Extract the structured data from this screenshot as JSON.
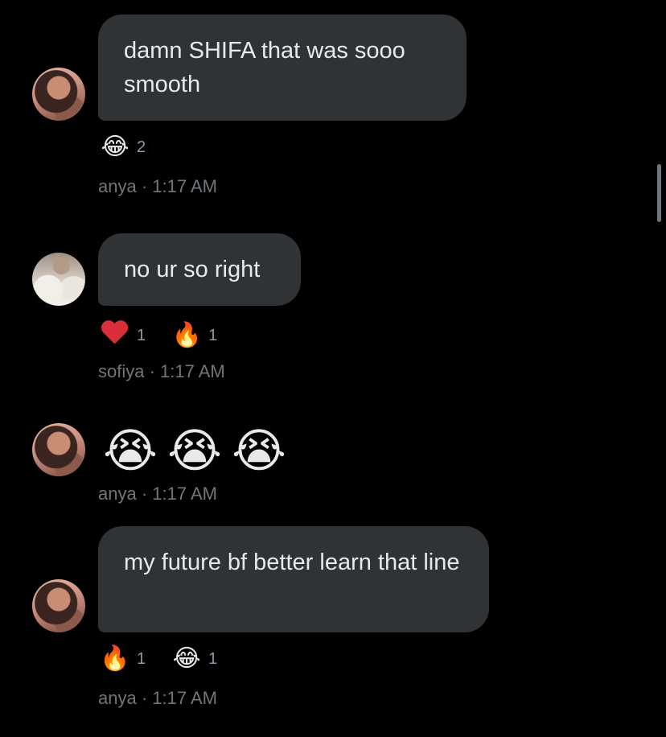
{
  "messages": [
    {
      "author": "anya",
      "text": "damn SHIFA that was sooo smooth",
      "reactions": [
        {
          "emoji": "😂",
          "icon": "face-with-tears-of-joy-icon",
          "count": "2"
        }
      ],
      "meta": "anya · 1:17 AM"
    },
    {
      "author": "sofiya",
      "text": "no ur so right",
      "reactions": [
        {
          "emoji": "❤",
          "icon": "red-heart-icon",
          "count": "1"
        },
        {
          "emoji": "🔥",
          "icon": "fire-icon",
          "count": "1"
        }
      ],
      "meta": "sofiya · 1:17 AM"
    },
    {
      "author": "anya",
      "emojis": [
        "😭",
        "😭",
        "😭"
      ],
      "emoji_icon": "loudly-crying-face-icon",
      "meta": "anya · 1:17 AM"
    },
    {
      "author": "anya",
      "text": "my future bf better learn that line",
      "reactions": [
        {
          "emoji": "🔥",
          "icon": "fire-icon",
          "count": "1"
        },
        {
          "emoji": "😂",
          "icon": "face-with-tears-of-joy-icon",
          "count": "1"
        }
      ],
      "meta": "anya · 1:17 AM"
    }
  ],
  "colors": {
    "background": "#000000",
    "bubble": "#2f3336",
    "text": "#e7e9ea",
    "meta_text": "#71767b",
    "heart": "#d92f3a"
  }
}
